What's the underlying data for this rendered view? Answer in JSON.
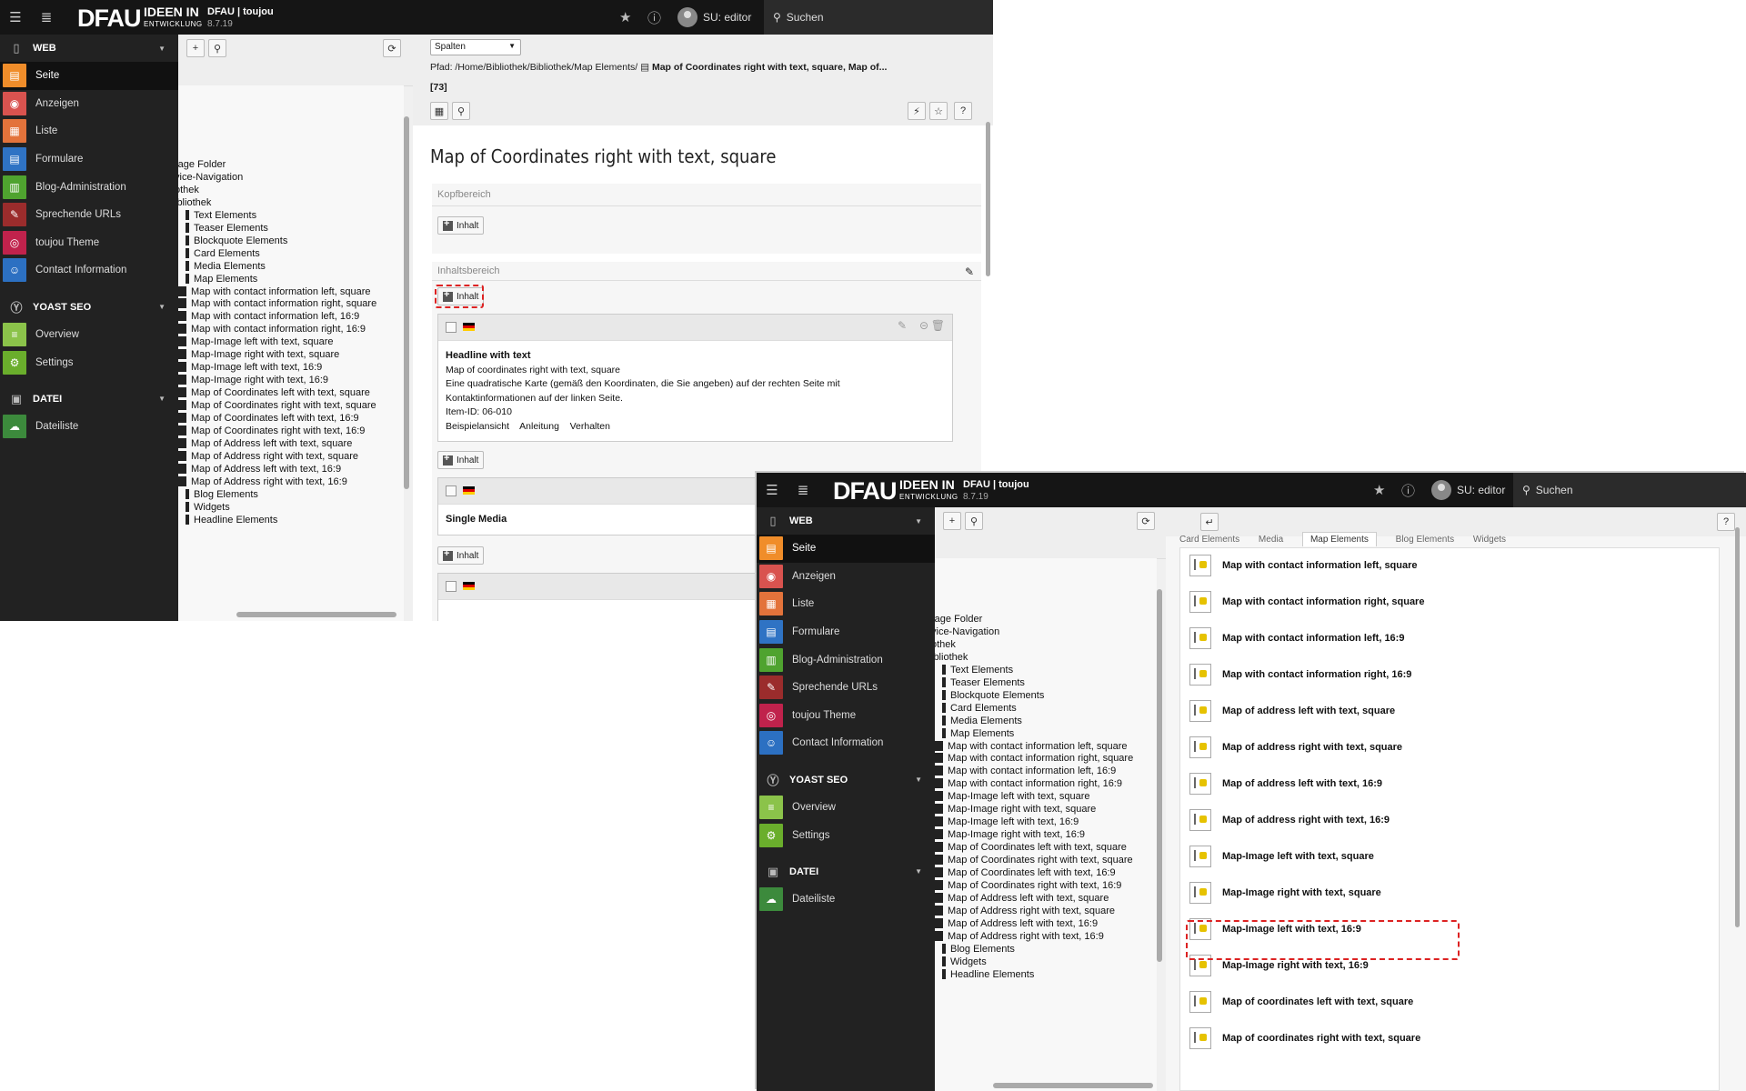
{
  "topbar": {
    "brand": "DFAU",
    "brand_sub": "IDEEN IN",
    "brand_sub2": "ENTWICKLUNG",
    "site_name": "DFAU | toujou",
    "version": "8.7.19",
    "user": "SU: editor",
    "search": "Suchen"
  },
  "sidebar": {
    "web": "WEB",
    "web_items": [
      "Seite",
      "Anzeigen",
      "Liste",
      "Formulare",
      "Blog-Administration",
      "Sprechende URLs",
      "toujou Theme",
      "Contact Information"
    ],
    "web_colors": [
      "#f08d2a",
      "#d9534f",
      "#e3733b",
      "#2f73c4",
      "#4fa32f",
      "#9b2c2c",
      "#c0224c",
      "#2c70c2"
    ],
    "yoast": "YOAST SEO",
    "yoast_items": [
      "Overview",
      "Settings"
    ],
    "yoast_colors": [
      "#8bc34a",
      "#6aae2c"
    ],
    "datei": "DATEI",
    "datei_items": [
      "Dateiliste"
    ],
    "datei_colors": [
      "#3c8a3c"
    ]
  },
  "tree": {
    "rows": [
      "rage Folder",
      "vice-Navigation",
      "othek",
      "ibliothek",
      "Text Elements",
      "Teaser Elements",
      "Blockquote Elements",
      "Card Elements",
      "Media Elements",
      "Map Elements",
      "Map with contact information left, square",
      "Map with contact information right, square",
      "Map with contact information left, 16:9",
      "Map with contact information right, 16:9",
      "Map-Image left with text, square",
      "Map-Image right with text, square",
      "Map-Image left with text, 16:9",
      "Map-Image right with text, 16:9",
      "Map of Coordinates left with text, square",
      "Map of Coordinates right with text, square",
      "Map of Coordinates left with text, 16:9",
      "Map of Coordinates right with text, 16:9",
      "Map of Address left with text, square",
      "Map of Address right with text, square",
      "Map of Address left with text, 16:9",
      "Map of Address right with text, 16:9",
      "Blog Elements",
      "Widgets",
      "Headline Elements"
    ]
  },
  "page": {
    "view_select": "Spalten",
    "path_label": "Pfad: /Home/Bibliothek/Bibliothek/Map Elements/",
    "path_page": "Map of Coordinates right with text, square, Map of...",
    "page_id": "[73]",
    "title": "Map of Coordinates right with text, square",
    "col_head": "Kopfbereich",
    "col_content": "Inhaltsbereich",
    "new_content": "Inhalt",
    "element1_headline": "Headline with text",
    "element1_line1": "Map of coordinates right with text, square",
    "element1_line2": "Eine quadratische Karte (gemäß den Koordinaten, die Sie angeben) auf der rechten Seite mit",
    "element1_line3": "Kontaktinformationen auf der linken Seite.",
    "element1_line4": "Item-ID: 06-010",
    "element1_links": [
      "Beispielansicht",
      "Anleitung",
      "Verhalten"
    ],
    "element2_headline": "Single Media"
  },
  "wizard": {
    "tabs": [
      "Card Elements",
      "Media",
      "Map Elements",
      "Blog Elements",
      "Widgets"
    ],
    "items": [
      "Map with contact information left, square",
      "Map with contact information right, square",
      "Map with contact information left, 16:9",
      "Map with contact information right, 16:9",
      "Map of address left with text, square",
      "Map of address right with text, square",
      "Map of address left with text, 16:9",
      "Map of address right with text, 16:9",
      "Map-Image left with text, square",
      "Map-Image right with text, square",
      "Map-Image left with text, 16:9",
      "Map-Image right with text, 16:9",
      "Map of coordinates left with text, square",
      "Map of coordinates right with text, square"
    ]
  }
}
